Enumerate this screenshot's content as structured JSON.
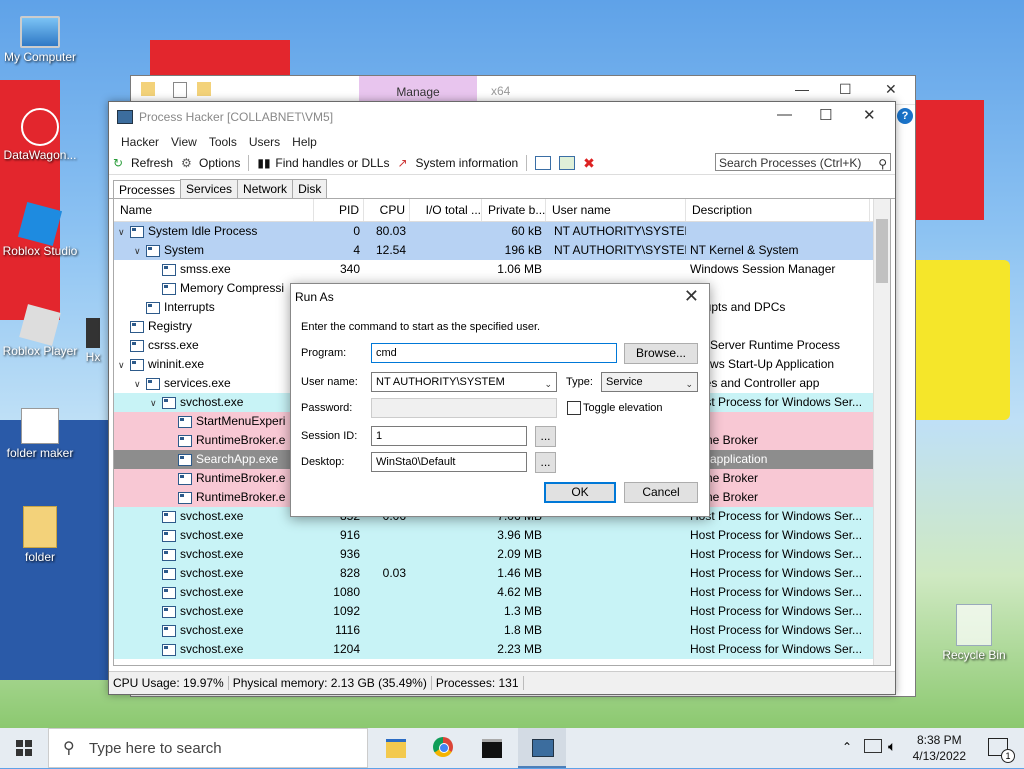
{
  "colors": {
    "selected": "#b7d2f3",
    "service": "#c8f3f6",
    "suspended": "#f8c8d4",
    "hilite": "#8d8d8d",
    "dialog_focus": "#0078d7",
    "taskbar": "#e6ecf2",
    "desktop_red": "#e3262d"
  },
  "desktop": {
    "icons": [
      {
        "label": "My Computer",
        "icon": "computer-icon"
      },
      {
        "label": "DataWagon...",
        "icon": "network-icon"
      },
      {
        "label": "Roblox Studio",
        "icon": "roblox-studio-icon"
      },
      {
        "label": "Roblox Player",
        "icon": "roblox-player-icon"
      },
      {
        "label": "Hx",
        "icon": "app-icon"
      },
      {
        "label": "folder maker",
        "icon": "gear-doc-icon"
      },
      {
        "label": "folder",
        "icon": "folder-icon"
      },
      {
        "label": "Recycle Bin",
        "icon": "recycle-bin-icon"
      }
    ]
  },
  "explorer_bg": {
    "context_tab": "Manage",
    "arch": "x64"
  },
  "process_hacker": {
    "title": "Process Hacker [COLLABNET\\VM5]",
    "menu": [
      "Hacker",
      "View",
      "Tools",
      "Users",
      "Help"
    ],
    "toolbar": {
      "refresh": "Refresh",
      "options": "Options",
      "find": "Find handles or DLLs",
      "sysinfo": "System information"
    },
    "search_placeholder": "Search Processes (Ctrl+K)",
    "tabs": [
      "Processes",
      "Services",
      "Network",
      "Disk"
    ],
    "columns": [
      "Name",
      "PID",
      "CPU",
      "I/O total ...",
      "Private b...",
      "User name",
      "Description"
    ],
    "rows": [
      {
        "indent": 0,
        "arrow": "v",
        "name": "System Idle Process",
        "pid": "0",
        "cpu": "80.03",
        "io": "",
        "priv": "60 kB",
        "user": "NT AUTHORITY\\SYSTEM",
        "desc": "",
        "style": "selected"
      },
      {
        "indent": 1,
        "arrow": "v",
        "name": "System",
        "pid": "4",
        "cpu": "12.54",
        "io": "",
        "priv": "196 kB",
        "user": "NT AUTHORITY\\SYSTEM",
        "desc": "NT Kernel & System",
        "style": "selected"
      },
      {
        "indent": 2,
        "arrow": "",
        "name": "smss.exe",
        "pid": "340",
        "cpu": "",
        "io": "",
        "priv": "1.06 MB",
        "user": "",
        "desc": "Windows Session Manager",
        "style": ""
      },
      {
        "indent": 2,
        "arrow": "",
        "name": "Memory Compressi",
        "pid": "",
        "cpu": "",
        "io": "",
        "priv": "",
        "user": "",
        "desc": "",
        "style": ""
      },
      {
        "indent": 1,
        "arrow": "",
        "name": "Interrupts",
        "pid": "",
        "cpu": "",
        "io": "",
        "priv": "",
        "user": "",
        "desc": "errupts and DPCs",
        "style": ""
      },
      {
        "indent": 0,
        "arrow": "",
        "name": "Registry",
        "pid": "",
        "cpu": "",
        "io": "",
        "priv": "",
        "user": "",
        "desc": "",
        "style": ""
      },
      {
        "indent": 0,
        "arrow": "",
        "name": "csrss.exe",
        "pid": "",
        "cpu": "",
        "io": "",
        "priv": "",
        "user": "",
        "desc": "ent Server Runtime Process",
        "style": ""
      },
      {
        "indent": 0,
        "arrow": "v",
        "name": "wininit.exe",
        "pid": "",
        "cpu": "",
        "io": "",
        "priv": "",
        "user": "",
        "desc": "ndows Start-Up Application",
        "style": ""
      },
      {
        "indent": 1,
        "arrow": "v",
        "name": "services.exe",
        "pid": "",
        "cpu": "",
        "io": "",
        "priv": "",
        "user": "",
        "desc": "vices and Controller app",
        "style": ""
      },
      {
        "indent": 2,
        "arrow": "v",
        "name": "svchost.exe",
        "pid": "",
        "cpu": "",
        "io": "",
        "priv": "",
        "user": "",
        "desc": "Host Process for Windows Ser...",
        "style": "service"
      },
      {
        "indent": 3,
        "arrow": "",
        "name": "StartMenuExperi",
        "pid": "",
        "cpu": "",
        "io": "",
        "priv": "",
        "user": "",
        "desc": "",
        "style": "suspended"
      },
      {
        "indent": 3,
        "arrow": "",
        "name": "RuntimeBroker.e",
        "pid": "",
        "cpu": "",
        "io": "",
        "priv": "",
        "user": "",
        "desc": "ntime Broker",
        "style": "suspended"
      },
      {
        "indent": 3,
        "arrow": "",
        "name": "SearchApp.exe",
        "pid": "",
        "cpu": "",
        "io": "",
        "priv": "",
        "user": "",
        "desc": "rch application",
        "style": "hilite"
      },
      {
        "indent": 3,
        "arrow": "",
        "name": "RuntimeBroker.e",
        "pid": "",
        "cpu": "",
        "io": "",
        "priv": "",
        "user": "",
        "desc": "ntime Broker",
        "style": "suspended"
      },
      {
        "indent": 3,
        "arrow": "",
        "name": "RuntimeBroker.e",
        "pid": "",
        "cpu": "",
        "io": "",
        "priv": "",
        "user": "",
        "desc": "ntime Broker",
        "style": "suspended"
      },
      {
        "indent": 2,
        "arrow": "",
        "name": "svchost.exe",
        "pid": "852",
        "cpu": "0.06",
        "io": "",
        "priv": "7.06 MB",
        "user": "",
        "desc": "Host Process for Windows Ser...",
        "style": "service"
      },
      {
        "indent": 2,
        "arrow": "",
        "name": "svchost.exe",
        "pid": "916",
        "cpu": "",
        "io": "",
        "priv": "3.96 MB",
        "user": "",
        "desc": "Host Process for Windows Ser...",
        "style": "service"
      },
      {
        "indent": 2,
        "arrow": "",
        "name": "svchost.exe",
        "pid": "936",
        "cpu": "",
        "io": "",
        "priv": "2.09 MB",
        "user": "",
        "desc": "Host Process for Windows Ser...",
        "style": "service"
      },
      {
        "indent": 2,
        "arrow": "",
        "name": "svchost.exe",
        "pid": "828",
        "cpu": "0.03",
        "io": "",
        "priv": "1.46 MB",
        "user": "",
        "desc": "Host Process for Windows Ser...",
        "style": "service"
      },
      {
        "indent": 2,
        "arrow": "",
        "name": "svchost.exe",
        "pid": "1080",
        "cpu": "",
        "io": "",
        "priv": "4.62 MB",
        "user": "",
        "desc": "Host Process for Windows Ser...",
        "style": "service"
      },
      {
        "indent": 2,
        "arrow": "",
        "name": "svchost.exe",
        "pid": "1092",
        "cpu": "",
        "io": "",
        "priv": "1.3 MB",
        "user": "",
        "desc": "Host Process for Windows Ser...",
        "style": "service"
      },
      {
        "indent": 2,
        "arrow": "",
        "name": "svchost.exe",
        "pid": "1116",
        "cpu": "",
        "io": "",
        "priv": "1.8 MB",
        "user": "",
        "desc": "Host Process for Windows Ser...",
        "style": "service"
      },
      {
        "indent": 2,
        "arrow": "",
        "name": "svchost.exe",
        "pid": "1204",
        "cpu": "",
        "io": "",
        "priv": "2.23 MB",
        "user": "",
        "desc": "Host Process for Windows Ser...",
        "style": "service"
      }
    ],
    "status": {
      "cpu": "CPU Usage: 19.97%",
      "mem": "Physical memory: 2.13 GB (35.49%)",
      "procs": "Processes: 131"
    }
  },
  "run_as": {
    "title": "Run As",
    "instruction": "Enter the command to start as the specified user.",
    "program_label": "Program:",
    "program_value": "cmd",
    "browse": "Browse...",
    "user_label": "User name:",
    "user_value": "NT AUTHORITY\\SYSTEM",
    "type_label": "Type:",
    "type_value": "Service",
    "password_label": "Password:",
    "toggle_label": "Toggle elevation",
    "session_label": "Session ID:",
    "session_value": "1",
    "desktop_label": "Desktop:",
    "desktop_value": "WinSta0\\Default",
    "ellipsis": "...",
    "ok": "OK",
    "cancel": "Cancel"
  },
  "taskbar": {
    "search_placeholder": "Type here to search",
    "apps": [
      "file-explorer-icon",
      "chrome-icon",
      "cmd-icon",
      "process-hacker-icon"
    ],
    "time": "8:38 PM",
    "date": "4/13/2022",
    "notifications": "1"
  }
}
